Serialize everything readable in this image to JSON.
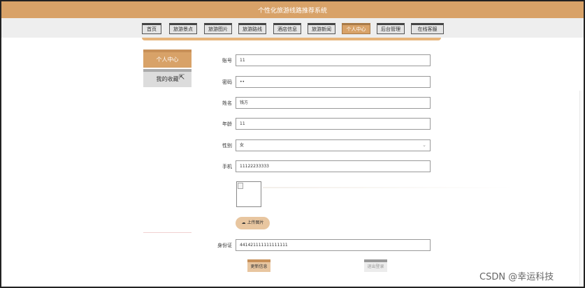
{
  "header": {
    "title": "个性化旅游线路推荐系统"
  },
  "nav": {
    "items": [
      {
        "label": "首页",
        "active": false
      },
      {
        "label": "旅游景点",
        "active": false
      },
      {
        "label": "旅游图片",
        "active": false
      },
      {
        "label": "旅游路线",
        "active": false
      },
      {
        "label": "酒店信息",
        "active": false
      },
      {
        "label": "旅游新闻",
        "active": false
      },
      {
        "label": "个人中心",
        "active": true
      },
      {
        "label": "后台管理",
        "active": false
      },
      {
        "label": "在线客服",
        "active": false
      }
    ]
  },
  "sidebar": {
    "items": [
      {
        "label": "个人中心",
        "active": true
      },
      {
        "label": "我的收藏",
        "active": false
      }
    ]
  },
  "form": {
    "account": {
      "label": "账号",
      "value": "11"
    },
    "password": {
      "label": "密码",
      "value": "••"
    },
    "name": {
      "label": "姓名",
      "value": "钱方"
    },
    "age": {
      "label": "年龄",
      "value": "11"
    },
    "gender": {
      "label": "性别",
      "value": "女"
    },
    "phone": {
      "label": "手机",
      "value": "11122233333"
    },
    "upload_label": "上传图片",
    "id_card": {
      "label": "身份证",
      "value": "441421111111111111"
    },
    "submit_label": "更新信息",
    "logout_label": "退出登录"
  },
  "watermark": "CSDN @幸运科技",
  "colors": {
    "accent": "#d8a268",
    "accent_light": "#e8c6a0",
    "nav_bg": "#eeeeee"
  }
}
